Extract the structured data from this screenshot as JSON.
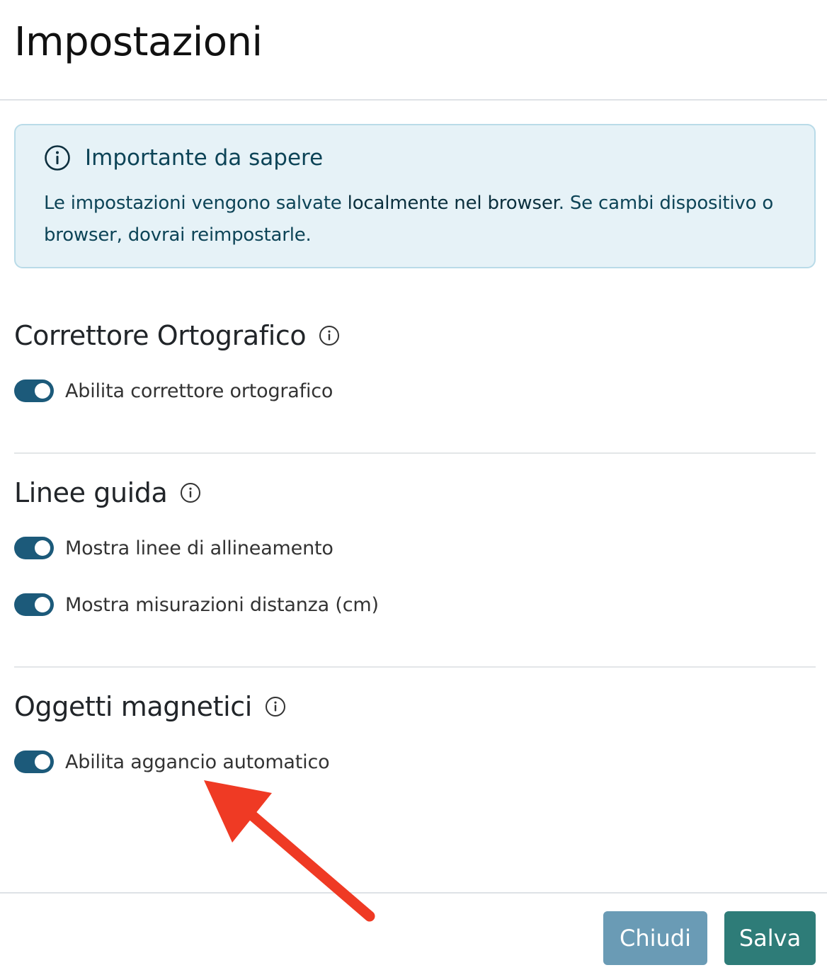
{
  "header": {
    "title": "Impostazioni"
  },
  "alert": {
    "icon": "info-circle-icon",
    "title": "Importante da sapere",
    "text_before": "Le impostazioni vengono salvate ",
    "text_emphasis": "localmente nel browser",
    "text_after": ". Se cambi dispositivo o browser, dovrai reimpostarle."
  },
  "sections": [
    {
      "title": "Correttore Ortografico",
      "help_icon": "info-circle-icon",
      "toggles": [
        {
          "label": "Abilita correttore ortografico",
          "checked": true
        }
      ]
    },
    {
      "title": "Linee guida",
      "help_icon": "info-circle-icon",
      "toggles": [
        {
          "label": "Mostra linee di allineamento",
          "checked": true
        },
        {
          "label": "Mostra misurazioni distanza (cm)",
          "checked": true
        }
      ]
    },
    {
      "title": "Oggetti magnetici",
      "help_icon": "info-circle-icon",
      "toggles": [
        {
          "label": "Abilita aggancio automatico",
          "checked": true
        }
      ]
    }
  ],
  "footer": {
    "close_label": "Chiudi",
    "save_label": "Salva"
  },
  "colors": {
    "toggle_on": "#1c5a7a",
    "close_button": "#6a9bb5",
    "save_button": "#2e7c78",
    "alert_bg": "#e6f2f7",
    "annotation_arrow": "#ef3a24"
  },
  "annotation": {
    "icon": "red-arrow-icon"
  }
}
